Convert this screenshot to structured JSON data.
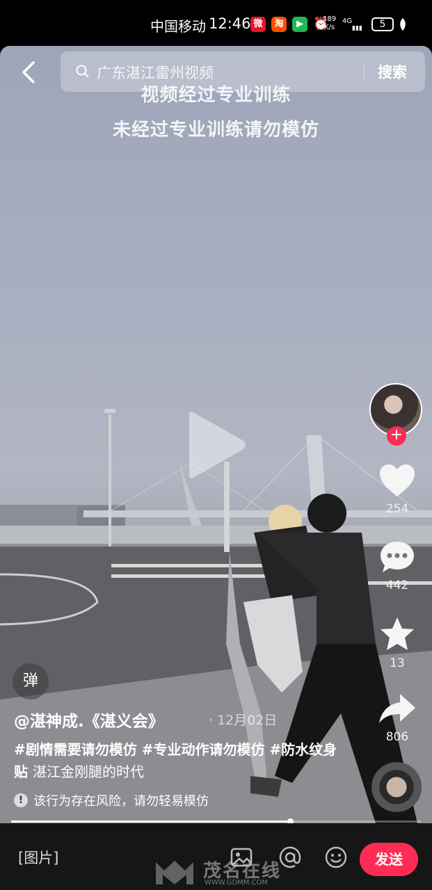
{
  "status_bar": {
    "carrier": "中国移动",
    "time": "12:46",
    "speed": "189",
    "speed_unit": "K/s",
    "network": "4G",
    "battery": "5"
  },
  "search": {
    "placeholder": "广东湛江雷州视频",
    "button_label": "搜索"
  },
  "video": {
    "caption_line1": "视频经过专业训练",
    "caption_line2": "未经过专业训练请勿模仿"
  },
  "side_actions": {
    "likes": "254",
    "comments": "442",
    "favorites": "13",
    "shares": "806"
  },
  "info": {
    "danmu_label": "弹",
    "author": "@湛神成.《湛义会》",
    "date": "· 12月02日",
    "tags_line": "#剧情需要请勿模仿 #专业动作请勿模仿 #防水纹身贴",
    "tags_plain": "湛江金刚腿的时代",
    "warning": "该行为存在风险，请勿轻易模仿"
  },
  "progress": {
    "fraction": 0.68
  },
  "bottom_bar": {
    "input_placeholder": "[图片]",
    "send_label": "发送"
  },
  "watermark": {
    "name": "茂名在线",
    "url": "WWW.GDMM.COM"
  },
  "colors": {
    "accent": "#fe2c55"
  }
}
